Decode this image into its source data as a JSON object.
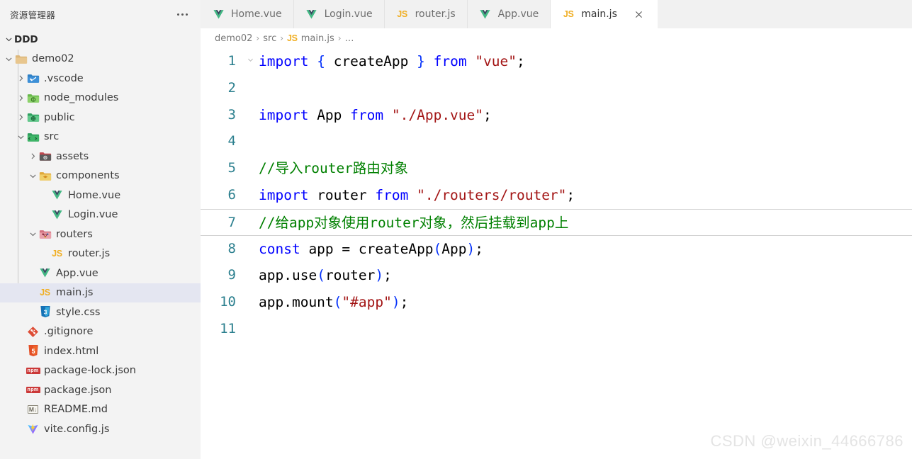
{
  "sidebar": {
    "title": "资源管理器",
    "more_label": "···",
    "root": {
      "label": "DDD",
      "expanded": true
    },
    "tree": [
      {
        "label": "demo02",
        "icon": "folder-open-icon",
        "depth": 1,
        "twisty": "down",
        "selected": false
      },
      {
        "label": ".vscode",
        "icon": "vscode-folder-icon",
        "depth": 2,
        "twisty": "right",
        "selected": false
      },
      {
        "label": "node_modules",
        "icon": "node-folder-icon",
        "depth": 2,
        "twisty": "right",
        "selected": false
      },
      {
        "label": "public",
        "icon": "public-folder-icon",
        "depth": 2,
        "twisty": "right",
        "selected": false
      },
      {
        "label": "src",
        "icon": "src-folder-icon",
        "depth": 2,
        "twisty": "down",
        "selected": false
      },
      {
        "label": "assets",
        "icon": "assets-folder-icon",
        "depth": 3,
        "twisty": "right",
        "selected": false
      },
      {
        "label": "components",
        "icon": "components-folder-icon",
        "depth": 3,
        "twisty": "down",
        "selected": false
      },
      {
        "label": "Home.vue",
        "icon": "vue-icon",
        "depth": 4,
        "twisty": "none",
        "selected": false
      },
      {
        "label": "Login.vue",
        "icon": "vue-icon",
        "depth": 4,
        "twisty": "none",
        "selected": false
      },
      {
        "label": "routers",
        "icon": "routers-folder-icon",
        "depth": 3,
        "twisty": "down",
        "selected": false
      },
      {
        "label": "router.js",
        "icon": "js-icon",
        "depth": 4,
        "twisty": "none",
        "selected": false
      },
      {
        "label": "App.vue",
        "icon": "vue-icon",
        "depth": 3,
        "twisty": "none",
        "selected": false
      },
      {
        "label": "main.js",
        "icon": "js-icon",
        "depth": 3,
        "twisty": "none",
        "selected": true
      },
      {
        "label": "style.css",
        "icon": "css-icon",
        "depth": 3,
        "twisty": "none",
        "selected": false
      },
      {
        "label": ".gitignore",
        "icon": "git-icon",
        "depth": 2,
        "twisty": "none",
        "selected": false
      },
      {
        "label": "index.html",
        "icon": "html-icon",
        "depth": 2,
        "twisty": "none",
        "selected": false
      },
      {
        "label": "package-lock.json",
        "icon": "npm-icon",
        "depth": 2,
        "twisty": "none",
        "selected": false
      },
      {
        "label": "package.json",
        "icon": "npm-icon",
        "depth": 2,
        "twisty": "none",
        "selected": false
      },
      {
        "label": "README.md",
        "icon": "markdown-icon",
        "depth": 2,
        "twisty": "none",
        "selected": false
      },
      {
        "label": "vite.config.js",
        "icon": "vite-icon",
        "depth": 2,
        "twisty": "none",
        "selected": false
      }
    ]
  },
  "tabs": [
    {
      "label": "Home.vue",
      "icon": "vue-icon",
      "active": false,
      "closable": false
    },
    {
      "label": "Login.vue",
      "icon": "vue-icon",
      "active": false,
      "closable": false
    },
    {
      "label": "router.js",
      "icon": "js-icon",
      "active": false,
      "closable": false
    },
    {
      "label": "App.vue",
      "icon": "vue-icon",
      "active": false,
      "closable": false
    },
    {
      "label": "main.js",
      "icon": "js-icon",
      "active": true,
      "closable": true
    }
  ],
  "breadcrumb": {
    "items": [
      {
        "label": "demo02",
        "icon": "none"
      },
      {
        "label": "src",
        "icon": "none"
      },
      {
        "label": "main.js",
        "icon": "js-icon"
      },
      {
        "label": "…",
        "icon": "none"
      }
    ],
    "separator": "›"
  },
  "editor": {
    "active_line": 7,
    "lines": [
      {
        "n": "1",
        "fold": "down",
        "tokens": [
          {
            "t": "import",
            "c": "k"
          },
          {
            "t": " ",
            "c": "p"
          },
          {
            "t": "{",
            "c": "br"
          },
          {
            "t": " createApp ",
            "c": "p"
          },
          {
            "t": "}",
            "c": "br"
          },
          {
            "t": " ",
            "c": "p"
          },
          {
            "t": "from",
            "c": "k"
          },
          {
            "t": " ",
            "c": "p"
          },
          {
            "t": "\"vue\"",
            "c": "s"
          },
          {
            "t": ";",
            "c": "p"
          }
        ]
      },
      {
        "n": "2",
        "fold": "none",
        "tokens": []
      },
      {
        "n": "3",
        "fold": "none",
        "tokens": [
          {
            "t": "import",
            "c": "k"
          },
          {
            "t": " App ",
            "c": "p"
          },
          {
            "t": "from",
            "c": "k"
          },
          {
            "t": " ",
            "c": "p"
          },
          {
            "t": "\"./App.vue\"",
            "c": "s"
          },
          {
            "t": ";",
            "c": "p"
          }
        ]
      },
      {
        "n": "4",
        "fold": "none",
        "tokens": []
      },
      {
        "n": "5",
        "fold": "none",
        "tokens": [
          {
            "t": "//导入router路由对象",
            "c": "c"
          }
        ]
      },
      {
        "n": "6",
        "fold": "none",
        "tokens": [
          {
            "t": "import",
            "c": "k"
          },
          {
            "t": " router ",
            "c": "p"
          },
          {
            "t": "from",
            "c": "k"
          },
          {
            "t": " ",
            "c": "p"
          },
          {
            "t": "\"./routers/router\"",
            "c": "s"
          },
          {
            "t": ";",
            "c": "p"
          }
        ]
      },
      {
        "n": "7",
        "fold": "none",
        "tokens": [
          {
            "t": "//给app对象使用router对象，然后挂载到app上",
            "c": "c"
          }
        ]
      },
      {
        "n": "8",
        "fold": "none",
        "tokens": [
          {
            "t": "const",
            "c": "k"
          },
          {
            "t": " app = createApp",
            "c": "p"
          },
          {
            "t": "(",
            "c": "br"
          },
          {
            "t": "App",
            "c": "p"
          },
          {
            "t": ")",
            "c": "br"
          },
          {
            "t": ";",
            "c": "p"
          }
        ]
      },
      {
        "n": "9",
        "fold": "none",
        "tokens": [
          {
            "t": "app.use",
            "c": "p"
          },
          {
            "t": "(",
            "c": "br"
          },
          {
            "t": "router",
            "c": "p"
          },
          {
            "t": ")",
            "c": "br"
          },
          {
            "t": ";",
            "c": "p"
          }
        ]
      },
      {
        "n": "10",
        "fold": "none",
        "tokens": [
          {
            "t": "app.mount",
            "c": "p"
          },
          {
            "t": "(",
            "c": "br"
          },
          {
            "t": "\"#app\"",
            "c": "s"
          },
          {
            "t": ")",
            "c": "br"
          },
          {
            "t": ";",
            "c": "p"
          }
        ]
      },
      {
        "n": "11",
        "fold": "none",
        "tokens": []
      }
    ]
  },
  "watermark": {
    "text": "CSDN @weixin_44666786"
  },
  "colors": {
    "sidebar_bg": "#f3f3f3",
    "tabbar_bg": "#f1f1f1",
    "editor_bg": "#ffffff",
    "selection_bg": "#e4e6f1",
    "keyword": "#0000ff",
    "string": "#a31515",
    "comment": "#008000",
    "linenumber": "#2b7f8e",
    "js_yellow": "#f0ae22",
    "vue_green": "#41b883"
  }
}
